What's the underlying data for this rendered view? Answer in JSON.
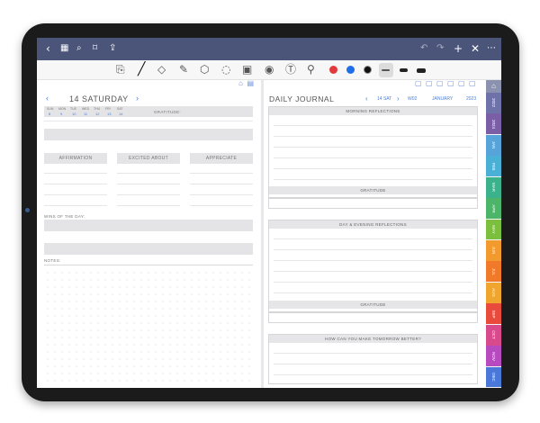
{
  "topbar": {
    "left_icons": [
      "chevron-left-icon",
      "grid-icon",
      "search-icon",
      "bookmark-icon",
      "share-icon"
    ],
    "right_icons": [
      "undo-icon",
      "redo-icon",
      "plus-icon",
      "close-icon",
      "more-icon"
    ]
  },
  "toolbar": {
    "tools": [
      "reader-icon",
      "pen-icon",
      "eraser-icon",
      "highlighter-icon",
      "shapes-icon",
      "lasso-icon",
      "image-icon",
      "camera-icon",
      "text-icon",
      "link-icon"
    ],
    "colors": [
      "#e23a3a",
      "#1f6ee8",
      "#111111"
    ]
  },
  "left": {
    "date_title": "14 SATURDAY",
    "week_days": [
      "SUN",
      "MON",
      "TUE",
      "WED",
      "THU",
      "FRI",
      "SAT"
    ],
    "week_dates": [
      "8",
      "9",
      "10",
      "11",
      "12",
      "13",
      "14"
    ],
    "gratitude_label": "GRATITUDE:",
    "columns": [
      "AFFIRMATION",
      "EXCITED ABOUT",
      "APPRECIATE"
    ],
    "wins_label": "WINS OF THE DAY:",
    "notes_label": "NOTES:"
  },
  "right": {
    "title": "DAILY JOURNAL",
    "date": "14 SAT",
    "week": "W02",
    "month": "JANUARY",
    "year": "2023",
    "morning": "MORNING REFLECTIONS",
    "gratitude1": "GRATITUDE",
    "evening": "DAY & EVENING REFLECTIONS",
    "gratitude2": "GRATITUDE",
    "tomorrow": "HOW CAN YOU MAKE TOMORROW BETTER?"
  },
  "tabs": [
    {
      "label": "2022",
      "color": "#6e72a8"
    },
    {
      "label": "2024",
      "color": "#7a5fa6"
    },
    {
      "label": "JAN",
      "color": "#56a4d9"
    },
    {
      "label": "FEB",
      "color": "#4ab0d6"
    },
    {
      "label": "MAR",
      "color": "#3bb28c"
    },
    {
      "label": "APR",
      "color": "#4cb56a"
    },
    {
      "label": "MAY",
      "color": "#7cbf3f"
    },
    {
      "label": "JUN",
      "color": "#f29a2e"
    },
    {
      "label": "JUL",
      "color": "#f07a2a"
    },
    {
      "label": "AUG",
      "color": "#f0a62e"
    },
    {
      "label": "SEP",
      "color": "#e84a3c"
    },
    {
      "label": "OCT",
      "color": "#d94a8c"
    },
    {
      "label": "NOV",
      "color": "#b84ac0"
    },
    {
      "label": "DEC",
      "color": "#4a78d9"
    }
  ]
}
